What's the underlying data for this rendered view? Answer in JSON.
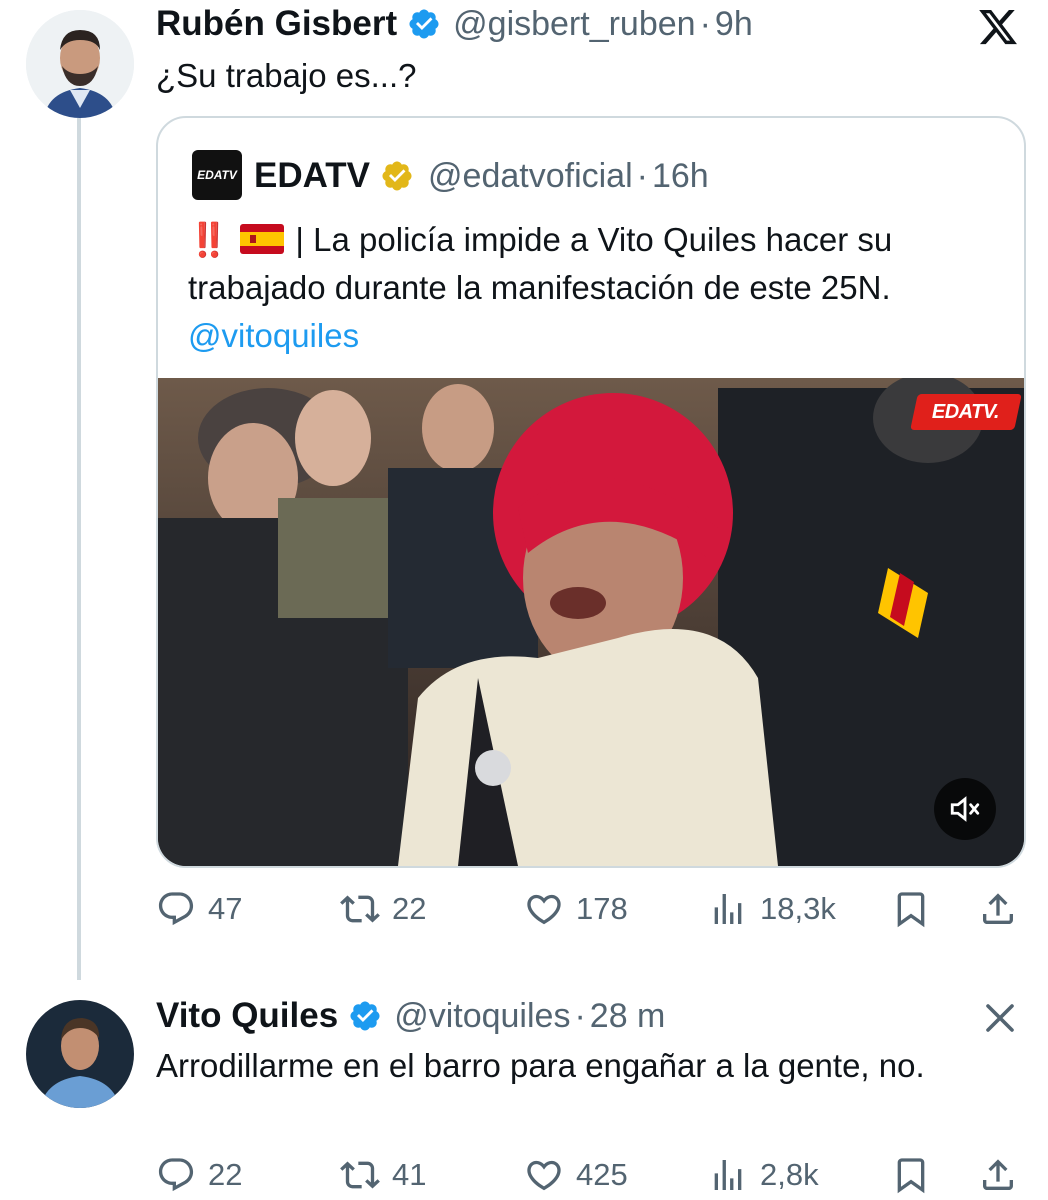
{
  "tweet1": {
    "name": "Rubén Gisbert",
    "handle": "@gisbert_ruben",
    "sep": "·",
    "time": "9h",
    "text": "¿Su trabajo es...?",
    "close_icon": "x-logo-icon"
  },
  "quote": {
    "avatar_text": "EDATV",
    "name": "EDATV",
    "handle": "@edatvoficial",
    "sep": "·",
    "time": "16h",
    "emoji_exclaim": "‼️",
    "text_prefix": " | La policía impide a Vito Quiles hacer su trabajado durante la manifestación de este 25N. ",
    "mention": "@vitoquiles",
    "video_watermark": "EDATV."
  },
  "tweet1_actions": {
    "replies": "47",
    "retweets": "22",
    "likes": "178",
    "views": "18,3k"
  },
  "tweet2": {
    "name": "Vito Quiles",
    "handle": "@vitoquiles",
    "sep": "·",
    "time": "28 m",
    "text": "Arrodillarme en el barro para engañar a la gente, no."
  },
  "tweet2_actions": {
    "replies": "22",
    "retweets": "41",
    "likes": "425",
    "views": "2,8k"
  },
  "colors": {
    "text": "#0f1419",
    "secondary": "#536471",
    "link": "#1d9bf0",
    "verified_blue": "#1d9bf0",
    "verified_gold": "#e2b719",
    "border": "#cfd9de"
  }
}
